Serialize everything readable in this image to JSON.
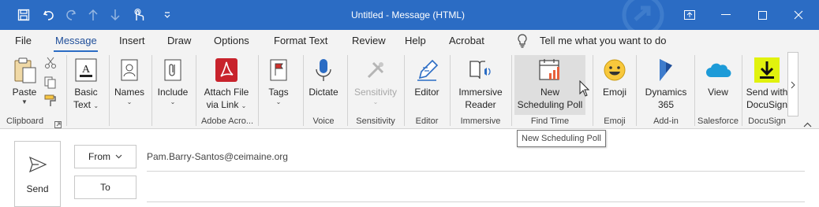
{
  "window": {
    "title": "Untitled  -  Message (HTML)",
    "accent": "#2b6cc4"
  },
  "menu": {
    "items": [
      "File",
      "Message",
      "Insert",
      "Draw",
      "Options",
      "Format Text",
      "Review",
      "Help",
      "Acrobat"
    ],
    "active": "Message",
    "tell_me": "Tell me what you want to do"
  },
  "ribbon": {
    "paste": "Paste",
    "basic_text_1": "Basic",
    "basic_text_2": "Text",
    "names": "Names",
    "include": "Include",
    "attach_1": "Attach File",
    "attach_2": "via Link",
    "tags": "Tags",
    "dictate": "Dictate",
    "sensitivity": "Sensitivity",
    "editor": "Editor",
    "immersive_1": "Immersive",
    "immersive_2": "Reader",
    "newpoll_1": "New",
    "newpoll_2": "Scheduling Poll",
    "emoji": "Emoji",
    "dynamics_1": "Dynamics",
    "dynamics_2": "365",
    "view": "View",
    "docusign_1": "Send with",
    "docusign_2": "DocuSign"
  },
  "groups": {
    "clipboard": "Clipboard",
    "adobe": "Adobe Acro...",
    "voice": "Voice",
    "sensitivity": "Sensitivity",
    "editor": "Editor",
    "immersive": "Immersive",
    "find_time": "Find Time",
    "emoji": "Emoji",
    "addin": "Add-in",
    "salesforce": "Salesforce",
    "docusign": "DocuSign"
  },
  "tooltip": "New Scheduling Poll",
  "compose": {
    "send": "Send",
    "from_label": "From",
    "from_value": "Pam.Barry-Santos@ceimaine.org",
    "to_label": "To"
  }
}
